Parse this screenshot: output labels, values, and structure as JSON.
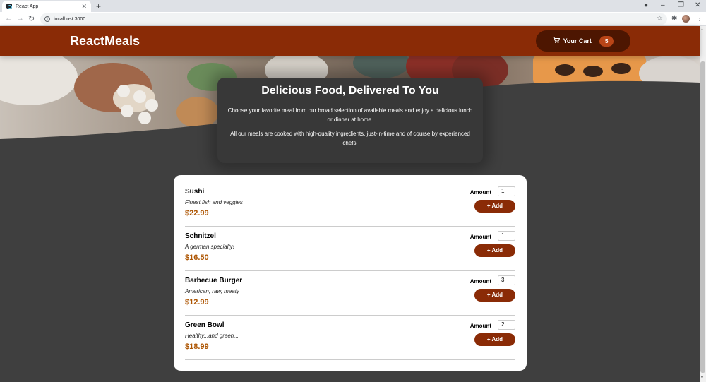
{
  "browser": {
    "tab_title": "React App",
    "url": "localhost:3000"
  },
  "header": {
    "title": "ReactMeals",
    "cart_label": "Your Cart",
    "cart_count": "5"
  },
  "summary": {
    "heading": "Delicious Food, Delivered To You",
    "paragraph1": "Choose your favorite meal from our broad selection of available meals and enjoy a delicious lunch or dinner at home.",
    "paragraph2": "All our meals are cooked with high-quality ingredients, just-in-time and of course by experienced chefs!"
  },
  "meals": {
    "amount_label": "Amount",
    "add_label": "+ Add",
    "items": [
      {
        "name": "Sushi",
        "description": "Finest fish and veggies",
        "price": "$22.99",
        "amount": "1"
      },
      {
        "name": "Schnitzel",
        "description": "A german specialty!",
        "price": "$16.50",
        "amount": "1"
      },
      {
        "name": "Barbecue Burger",
        "description": "American, raw, meaty",
        "price": "$12.99",
        "amount": "3"
      },
      {
        "name": "Green Bowl",
        "description": "Healthy...and green...",
        "price": "$18.99",
        "amount": "2"
      }
    ]
  },
  "colors": {
    "header_bg": "#8a2b06",
    "cart_bg": "#4d1601",
    "badge_bg": "#b94517",
    "price": "#ad5502",
    "page_bg": "#3f3f3f",
    "summary_bg": "#383838"
  },
  "icons": [
    "react-favicon",
    "close-icon",
    "plus-icon",
    "back-arrow-icon",
    "forward-arrow-icon",
    "reload-icon",
    "info-icon",
    "star-icon",
    "puzzle-icon",
    "profile-avatar",
    "menu-dots-icon",
    "cart-icon"
  ]
}
